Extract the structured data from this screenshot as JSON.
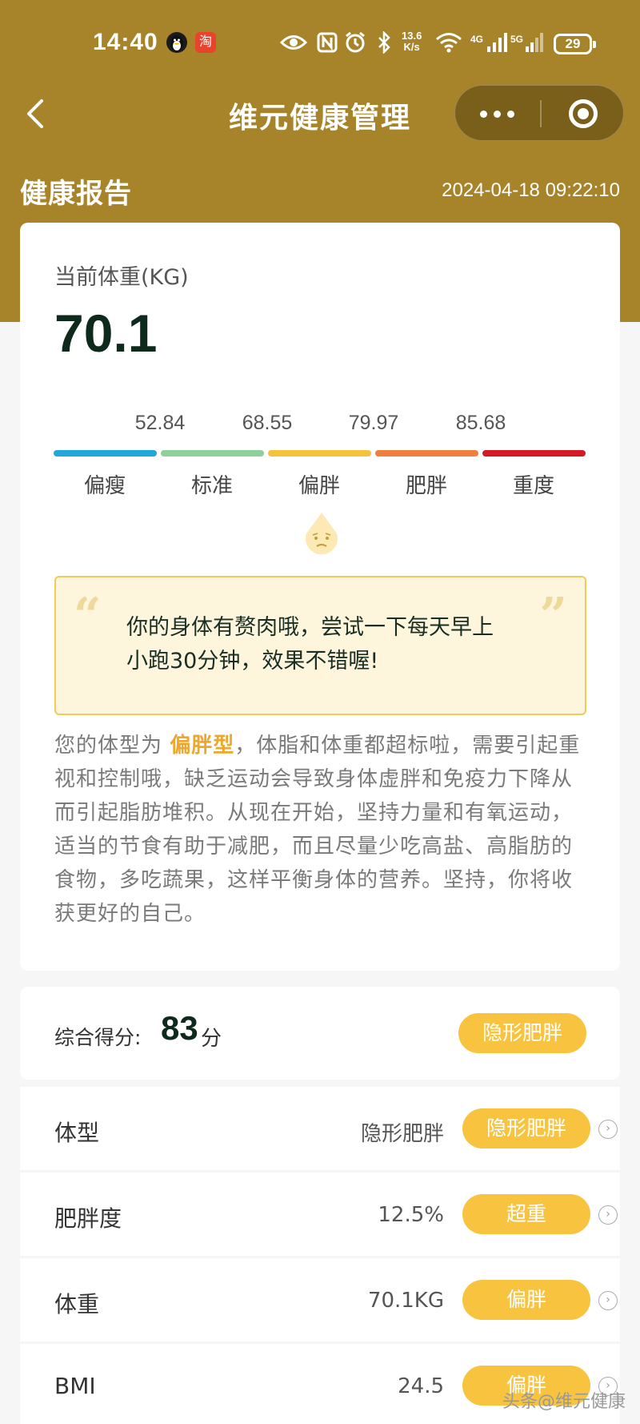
{
  "status_bar": {
    "time": "14:40",
    "net_speed_value": "13.6",
    "net_speed_unit": "K/s",
    "signal1": "4G",
    "signal2": "5G",
    "battery": "29",
    "app_badge": "淘"
  },
  "nav": {
    "title": "维元健康管理"
  },
  "report": {
    "title": "健康报告",
    "timestamp": "2024-04-18 09:22:10"
  },
  "weight": {
    "label": "当前体重(KG)",
    "value": "70.1"
  },
  "scale": {
    "thresholds": [
      "52.84",
      "68.55",
      "79.97",
      "85.68"
    ],
    "categories": [
      "偏瘦",
      "标准",
      "偏胖",
      "肥胖",
      "重度"
    ],
    "colors": [
      "#1fa8d8",
      "#8fcf9a",
      "#f5c23c",
      "#f07f3e",
      "#d41b25"
    ],
    "current_category_index": 2
  },
  "quote": {
    "line1": "你的身体有赘肉哦，尝试一下每天早上",
    "line2": "小跑30分钟，效果不错喔!"
  },
  "description": {
    "prefix": "您的体型为",
    "highlight": "偏胖型",
    "suffix": "，体脂和体重都超标啦，需要引起重视和控制哦，缺乏运动会导致身体虚胖和免疫力下降从而引起脂肪堆积。从现在开始，坚持力量和有氧运动，适当的节食有助于减肥，而且尽量少吃高盐、高脂肪的食物，多吃蔬果，这样平衡身体的营养。坚持，你将收获更好的自己。"
  },
  "score": {
    "label": "综合得分:",
    "value": "83",
    "unit": "分",
    "badge": "隐形肥胖"
  },
  "metrics": [
    {
      "label": "体型",
      "value": "隐形肥胖",
      "badge": "隐形肥胖"
    },
    {
      "label": "肥胖度",
      "value": "12.5%",
      "badge": "超重"
    },
    {
      "label": "体重",
      "value": "70.1KG",
      "badge": "偏胖"
    },
    {
      "label": "BMI",
      "value": "24.5",
      "badge": "偏胖"
    }
  ],
  "watermark": "头条@维元健康",
  "colors": {
    "header": "#a7832a",
    "accent": "#f8c33f",
    "highlight": "#eea72a"
  }
}
